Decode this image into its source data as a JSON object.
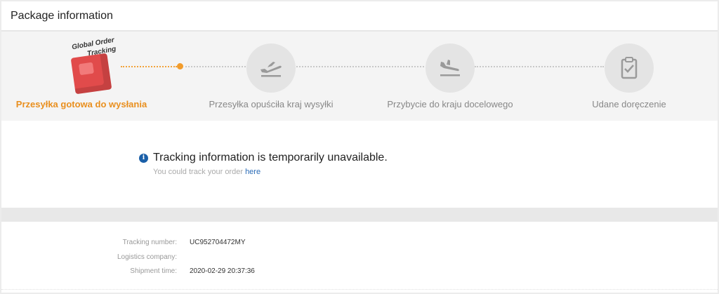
{
  "header": {
    "title": "Package information"
  },
  "logo": {
    "line1": "Global Order",
    "line2": "Tracking"
  },
  "steps": [
    {
      "label": "Przesyłka gotowa do wysłania",
      "icon": "box-icon",
      "active": true
    },
    {
      "label": "Przesyłka opuściła kraj wysyłki",
      "icon": "plane-departure-icon",
      "active": false
    },
    {
      "label": "Przybycie do kraju docelowego",
      "icon": "plane-arrival-icon",
      "active": false
    },
    {
      "label": "Udane doręczenie",
      "icon": "clipboard-check-icon",
      "active": false
    }
  ],
  "notice": {
    "title": "Tracking information is temporarily unavailable.",
    "sub_prefix": "You could track your order ",
    "link": "here"
  },
  "details": {
    "tracking_label": "Tracking number:",
    "tracking_value": "UC952704472MY",
    "company_label": "Logistics company:",
    "company_value": "",
    "time_label": "Shipment time:",
    "time_value": "2020-02-29 20:37:36"
  },
  "colors": {
    "accent": "#e98f1e",
    "link": "#2b6cb7",
    "info": "#1a5fa8"
  }
}
